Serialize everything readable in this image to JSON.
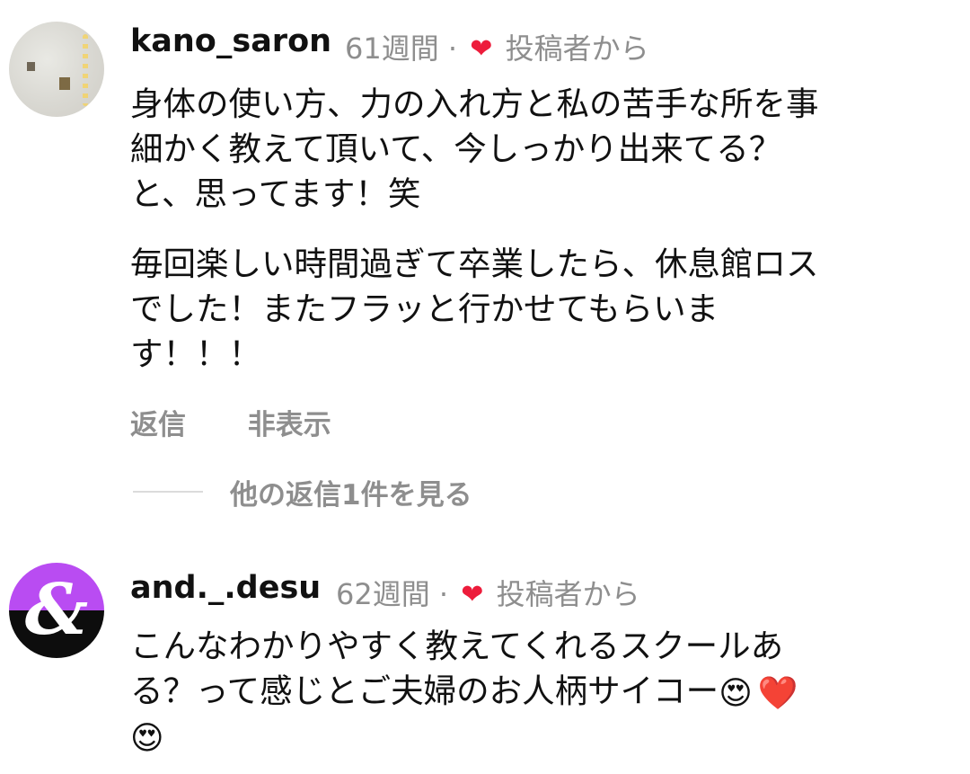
{
  "comments": [
    {
      "username": "kano_saron",
      "time": "61週間",
      "separator": "·",
      "heart_glyph": "❤",
      "from_author": "投稿者から",
      "text_lines": [
        "身体の使い方、力の入れ方と私の苦手な所を事",
        "細かく教えて頂いて、今しっかり出来てる？",
        "と、思ってます！笑",
        "毎回楽しい時間過ぎて卒業したら、休息館ロス",
        "でした！またフラッと行かせてもらいま",
        "す！！！"
      ],
      "reply_label": "返信",
      "hide_label": "非表示",
      "view_replies_label": "他の返信1件を見る"
    },
    {
      "username": "and._.desu",
      "time": "62週間",
      "separator": "·",
      "heart_glyph": "❤",
      "from_author": "投稿者から",
      "avatar_glyph": "&",
      "text_lines": [
        "こんなわかりやすく教えてくれるスクールあ",
        "る？って感じとご夫婦のお人柄サイコー",
        ""
      ],
      "emojis": [
        "😍",
        "❤️",
        "😍"
      ]
    }
  ],
  "colors": {
    "username": "#111111",
    "meta": "#8e8e8e",
    "heart": "#ed1c3b",
    "avatar2_top": "#b94cf2",
    "avatar2_bottom": "#0d0d0d"
  }
}
